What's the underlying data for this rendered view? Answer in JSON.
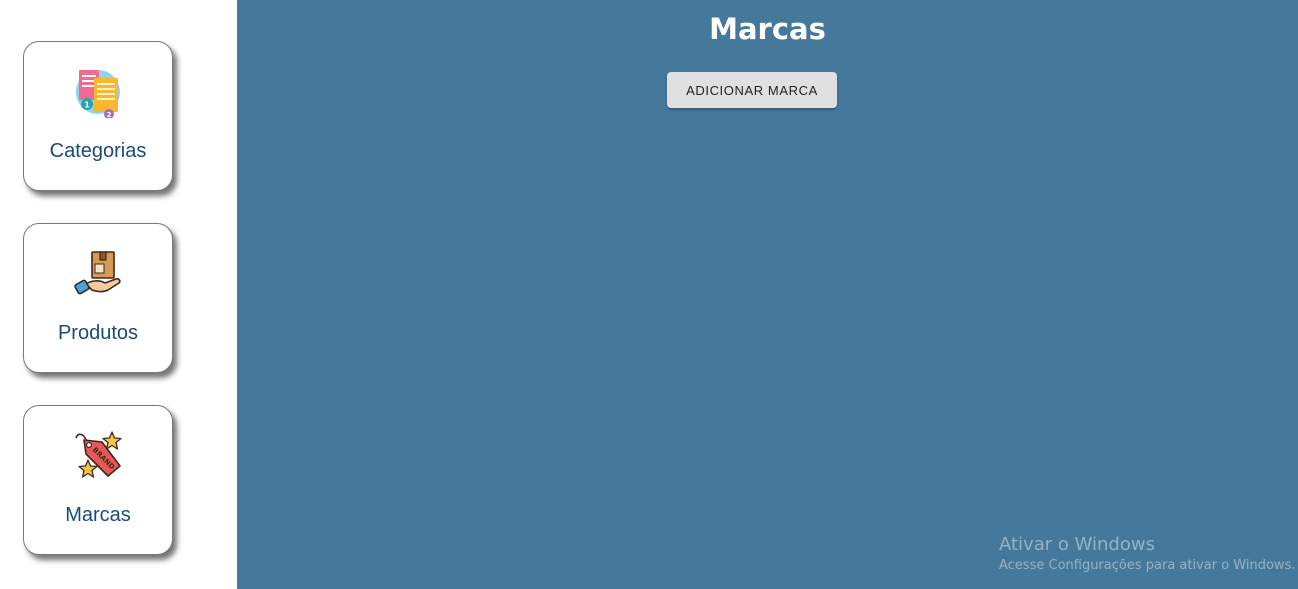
{
  "sidebar": {
    "items": [
      {
        "label": "Categorias",
        "icon": "categories-icon"
      },
      {
        "label": "Produtos",
        "icon": "product-box-hand-icon"
      },
      {
        "label": "Marcas",
        "icon": "brand-tag-icon"
      }
    ]
  },
  "main": {
    "title": "Marcas",
    "add_button_label": "ADICIONAR MARCA",
    "background_color": "#45799c"
  },
  "watermark": {
    "title": "Ativar o Windows",
    "subtitle": "Acesse Configurações para ativar o Windows."
  }
}
